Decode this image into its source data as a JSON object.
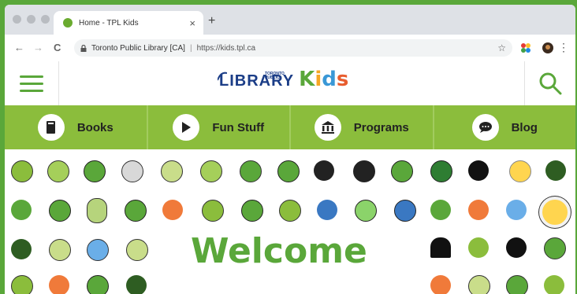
{
  "browser": {
    "tab_title": "Home - TPL Kids",
    "tab_close": "×",
    "new_tab": "+",
    "nav_back": "←",
    "nav_forward": "→",
    "nav_reload": "C",
    "org": "Toronto Public Library [CA]",
    "separator": "|",
    "url": "https://kids.tpl.ca",
    "bookmark": "☆",
    "menu": "⋮"
  },
  "site": {
    "logo_small": "TORONTO PUBLIC",
    "logo_library": "LIBRARY",
    "logo_kids": [
      "K",
      "i",
      "d",
      "s"
    ],
    "menu": [
      {
        "label": "Books",
        "icon": "book-icon"
      },
      {
        "label": "Fun Stuff",
        "icon": "play-icon"
      },
      {
        "label": "Programs",
        "icon": "building-icon"
      },
      {
        "label": "Blog",
        "icon": "speech-bubble-icon"
      }
    ],
    "welcome": "Welcome"
  },
  "colors": {
    "green": "#5aa73a",
    "menu_green": "#8bbd3c",
    "navy": "#1b3d87",
    "orange": "#f6a623",
    "blue": "#3a98d6",
    "red": "#e85d2f"
  }
}
